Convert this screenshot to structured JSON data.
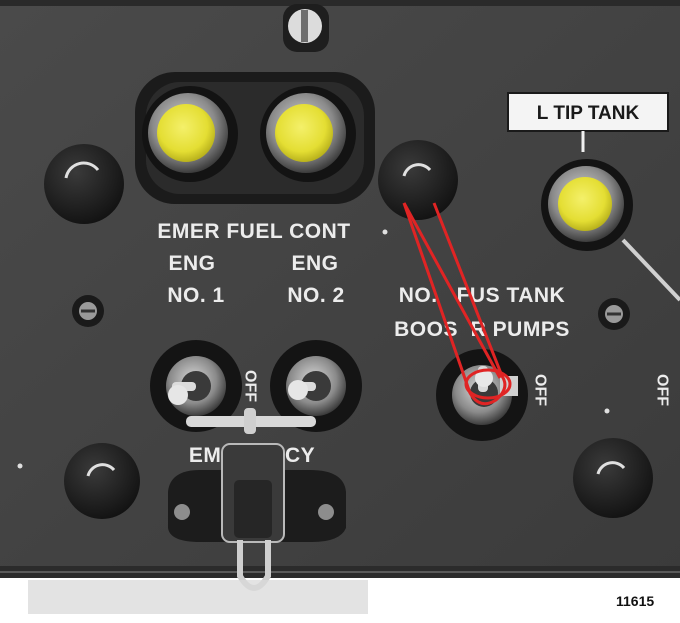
{
  "placard": {
    "left_tip_tank": "L TIP TANK"
  },
  "labels": {
    "emer_fuel_cont": "EMER FUEL CONT",
    "eng_left": "ENG",
    "eng_right": "ENG",
    "no_1": "NO. 1",
    "no_2": "NO. 2",
    "fus_tank_line": "NO.   FUS TANK",
    "booster_pumps": "BOOS  R PUMPS",
    "emergency": "EME   ENCY",
    "off_left": "OFF",
    "off_center": "OFF",
    "off_right": "OFF"
  },
  "figure_number": "11615",
  "colors": {
    "panel": "#434343",
    "caution_light": "#e7e23a",
    "annotation_wire": "#e02424",
    "lettering": "#ececec"
  },
  "icons": [
    "screw-head",
    "indicator-light",
    "toggle-switch",
    "safety-wire",
    "guard-latch"
  ]
}
